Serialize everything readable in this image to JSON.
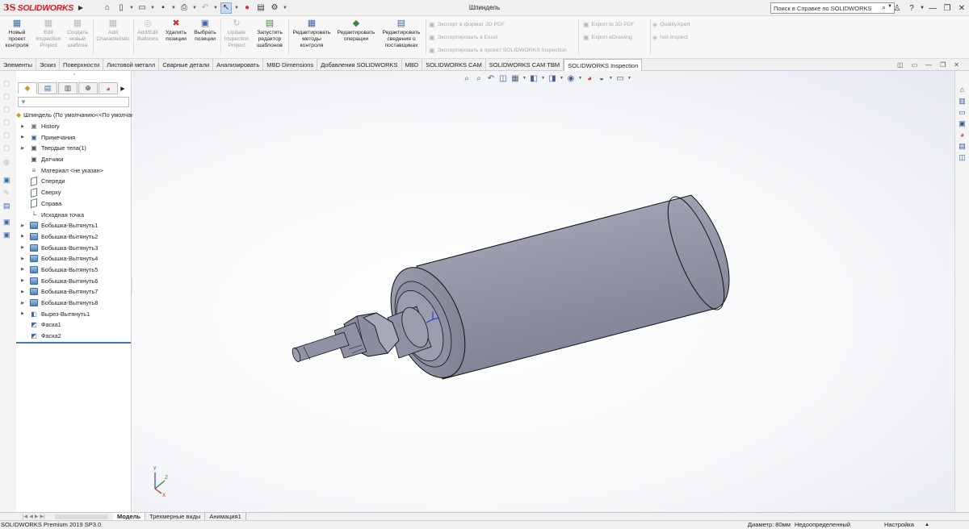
{
  "app": {
    "logo_mark": "3S",
    "logo_text": "SOLIDWORKS",
    "document_title": "Шпиндель",
    "search_placeholder": "Поиск в Справке по SOLIDWORKS"
  },
  "quick_access": [
    "home-icon",
    "new-file-icon",
    "open-icon",
    "save-icon",
    "print-icon",
    "undo-icon",
    "select-icon",
    "rebuild-icon",
    "file-properties-icon",
    "options-icon"
  ],
  "ribbon": {
    "buttons": [
      {
        "label": "Новый проект контроля",
        "enabled": true
      },
      {
        "label": "Edit Inspection Project",
        "enabled": false
      },
      {
        "label": "Создать новый шаблон",
        "enabled": false
      },
      {
        "label": "Add Characteristic",
        "enabled": false
      },
      {
        "label": "Add/Edit Balloons",
        "enabled": false
      },
      {
        "label": "Удалить позиции",
        "enabled": true
      },
      {
        "label": "Выбрать позиции",
        "enabled": true
      },
      {
        "label": "Update Inspection Project",
        "enabled": false
      },
      {
        "label": "Запустить редактор шаблонов",
        "enabled": true
      },
      {
        "label": "Редактировать методы контроля",
        "enabled": true
      },
      {
        "label": "Редактировать операции",
        "enabled": true
      },
      {
        "label": "Редактировать сведения о поставщиках",
        "enabled": true
      }
    ],
    "small_buttons": [
      "Экспорт в формат 2D PDF",
      "Экспортировать в Excel",
      "Экспортировать в проект SOLIDWORKS Inspection",
      "Export to 3D PDF",
      "Export eDrawing",
      "QualityXpert",
      "Net-Inspect"
    ]
  },
  "tabs": [
    {
      "label": "Элементы",
      "active": false
    },
    {
      "label": "Эскиз",
      "active": false
    },
    {
      "label": "Поверхности",
      "active": false
    },
    {
      "label": "Листовой металл",
      "active": false
    },
    {
      "label": "Сварные детали",
      "active": false
    },
    {
      "label": "Анализировать",
      "active": false
    },
    {
      "label": "MBD Dimensions",
      "active": false
    },
    {
      "label": "Добавления SOLIDWORKS",
      "active": false
    },
    {
      "label": "MBD",
      "active": false
    },
    {
      "label": "SOLIDWORKS CAM",
      "active": false
    },
    {
      "label": "SOLIDWORKS CAM TBM",
      "active": false
    },
    {
      "label": "SOLIDWORKS Inspection",
      "active": true
    }
  ],
  "feature_tree": {
    "root": "Шпиндель  (По умолчанию<<По умолчанию>",
    "items": [
      {
        "label": "History",
        "icon": "history-folder-icon",
        "expandable": true
      },
      {
        "label": "Примечания",
        "icon": "annotations-icon",
        "expandable": true
      },
      {
        "label": "Твердые тела(1)",
        "icon": "solid-bodies-icon",
        "expandable": true
      },
      {
        "label": "Датчики",
        "icon": "sensors-icon",
        "expandable": false
      },
      {
        "label": "Материал <не указан>",
        "icon": "material-icon",
        "expandable": false
      },
      {
        "label": "Спереди",
        "icon": "plane-icon",
        "expandable": false
      },
      {
        "label": "Сверху",
        "icon": "plane-icon",
        "expandable": false
      },
      {
        "label": "Справа",
        "icon": "plane-icon",
        "expandable": false
      },
      {
        "label": "Исходная точка",
        "icon": "origin-icon",
        "expandable": false
      },
      {
        "label": "Бобышка-Вытянуть1",
        "icon": "boss-extrude-icon",
        "expandable": true
      },
      {
        "label": "Бобышка-Вытянуть2",
        "icon": "boss-extrude-icon",
        "expandable": true
      },
      {
        "label": "Бобышка-Вытянуть3",
        "icon": "boss-extrude-icon",
        "expandable": true
      },
      {
        "label": "Бобышка-Вытянуть4",
        "icon": "boss-extrude-icon",
        "expandable": true
      },
      {
        "label": "Бобышка-Вытянуть5",
        "icon": "boss-extrude-icon",
        "expandable": true
      },
      {
        "label": "Бобышка-Вытянуть6",
        "icon": "boss-extrude-icon",
        "expandable": true
      },
      {
        "label": "Бобышка-Вытянуть7",
        "icon": "boss-extrude-icon",
        "expandable": true
      },
      {
        "label": "Бобышка-Вытянуть8",
        "icon": "boss-extrude-icon",
        "expandable": true
      },
      {
        "label": "Вырез-Вытянуть1",
        "icon": "cut-extrude-icon",
        "expandable": true
      },
      {
        "label": "Фаска1",
        "icon": "chamfer-icon",
        "expandable": false
      },
      {
        "label": "Фаска2",
        "icon": "chamfer-icon",
        "expandable": false
      }
    ]
  },
  "bottom_tabs": [
    {
      "label": "Модель",
      "active": true
    },
    {
      "label": "Трехмерные виды",
      "active": false
    },
    {
      "label": "Анимация1",
      "active": false
    }
  ],
  "status": {
    "product": "SOLIDWORKS Premium 2019 SP3.0",
    "measurement": "Диаметр: 80мм",
    "definition": "Недоопределенный",
    "settings": "Настройка"
  },
  "colors": {
    "brand": "#d71920",
    "model_body": "#8f93a6",
    "active_tab_underline": "#3a7ac0"
  }
}
